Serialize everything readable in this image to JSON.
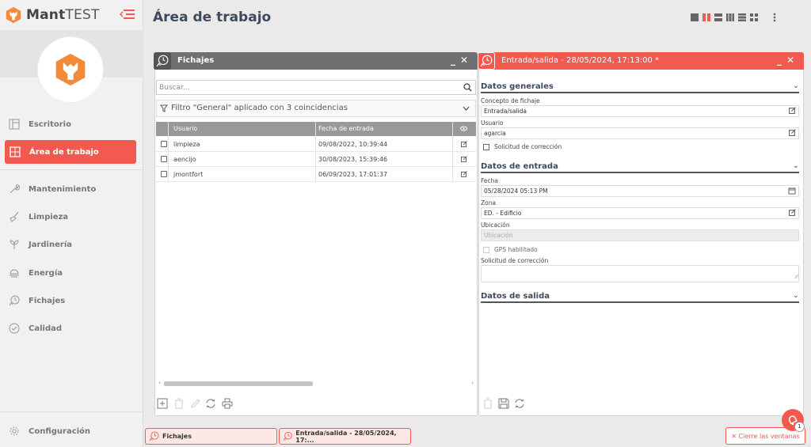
{
  "app": {
    "name_bold": "Mant",
    "name_rest": "TEST"
  },
  "sidebar": {
    "items": [
      {
        "label": "Escritorio",
        "icon": "desktop-icon"
      },
      {
        "label": "Área de trabajo",
        "icon": "workspace-icon",
        "active": true
      },
      {
        "label": "Mantenimiento",
        "icon": "wrench-icon"
      },
      {
        "label": "Limpieza",
        "icon": "broom-icon"
      },
      {
        "label": "Jardinería",
        "icon": "garden-icon"
      },
      {
        "label": "Energía",
        "icon": "energy-icon"
      },
      {
        "label": "Fichajes",
        "icon": "clock-hand-icon"
      },
      {
        "label": "Calidad",
        "icon": "check-circle-icon"
      }
    ],
    "config_label": "Configuración"
  },
  "header": {
    "title": "Área de trabajo"
  },
  "colors": {
    "accent": "#f25a4f",
    "panel_title_left": "#707070",
    "sidebar_bg": "#f1f1f1"
  },
  "left_panel": {
    "title": "Fichajes",
    "search_placeholder": "Buscar...",
    "filter_text": "Filtro \"General\" aplicado con 3 coincidencias",
    "columns": [
      "Usuario",
      "Fecha de entrada"
    ],
    "rows": [
      {
        "usuario": "limpieza",
        "fecha": "09/08/2022, 10:39:44"
      },
      {
        "usuario": "aencijo",
        "fecha": "30/08/2023, 15:39:46"
      },
      {
        "usuario": "jmontfort",
        "fecha": "06/09/2023, 17:01:37"
      }
    ]
  },
  "right_panel": {
    "title": "Entrada/salida - 28/05/2024, 17:13:00 *",
    "sections": {
      "general": "Datos generales",
      "entrada": "Datos de entrada",
      "salida": "Datos de salida"
    },
    "fields": {
      "concepto_label": "Concepto de fichaje",
      "concepto_value": "Entrada/salida",
      "usuario_label": "Usuario",
      "usuario_value": "agarcia",
      "solicitud_check": "Solicitud de corrección",
      "fecha_label": "Fecha",
      "fecha_value": "05/28/2024 05:13 PM",
      "zona_label": "Zona",
      "zona_value": "ED. - Edificio",
      "ubicacion_label": "Ubicación",
      "ubicacion_placeholder": "Ubicación",
      "gps_check": "GPS habilitado",
      "solicitud_label": "Solicitud de corrección"
    }
  },
  "taskbar": {
    "task1": "Fichajes",
    "task2": "Entrada/salida - 28/05/2024, 17:...",
    "close_all": "✕ Cierre las ventanas",
    "badge": "1"
  }
}
